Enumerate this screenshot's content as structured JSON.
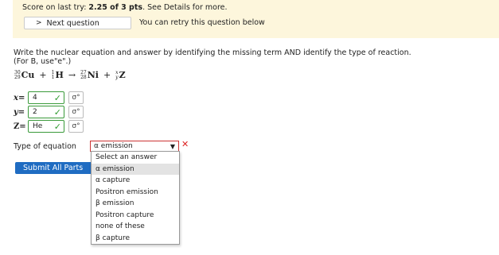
{
  "banner": {
    "score_prefix": "Score on last try: ",
    "score_value": "2.25 of 3 pts",
    "score_suffix": ". See Details for more.",
    "next_label": "Next question",
    "retry_text": "You can retry this question below"
  },
  "question": {
    "line1": "Write the nuclear equation and answer by identifying the missing term AND identify the type of reaction.",
    "line2": "(For B, use\"e\".)"
  },
  "equation": {
    "n1": {
      "mass": "30",
      "atomic": "29",
      "symbol": "Cu"
    },
    "op1": "+",
    "n2": {
      "mass": "1",
      "atomic": "1",
      "symbol": "H"
    },
    "arrow": "→",
    "n3": {
      "mass": "27",
      "atomic": "28",
      "symbol": "Ni"
    },
    "op2": "+",
    "n4": {
      "mass": "x",
      "atomic": "y",
      "symbol": "Z"
    }
  },
  "answers": [
    {
      "label": "x=",
      "value": "4"
    },
    {
      "label": "y=",
      "value": "2"
    },
    {
      "label": "Z=",
      "value": "He"
    }
  ],
  "key_icon_text": "σ°",
  "type_label": "Type of equation",
  "select_value": "α emission",
  "submit_label": "Submit All Parts",
  "options": [
    "Select an answer",
    "α emission",
    "α capture",
    "Positron emission",
    "β emission",
    "Positron capture",
    "none of these",
    "β capture"
  ],
  "colors": {
    "banner_bg": "#fdf6dc",
    "correct": "#3a9a3a",
    "error": "#cc2222",
    "submit_bg": "#1f6cc2"
  }
}
